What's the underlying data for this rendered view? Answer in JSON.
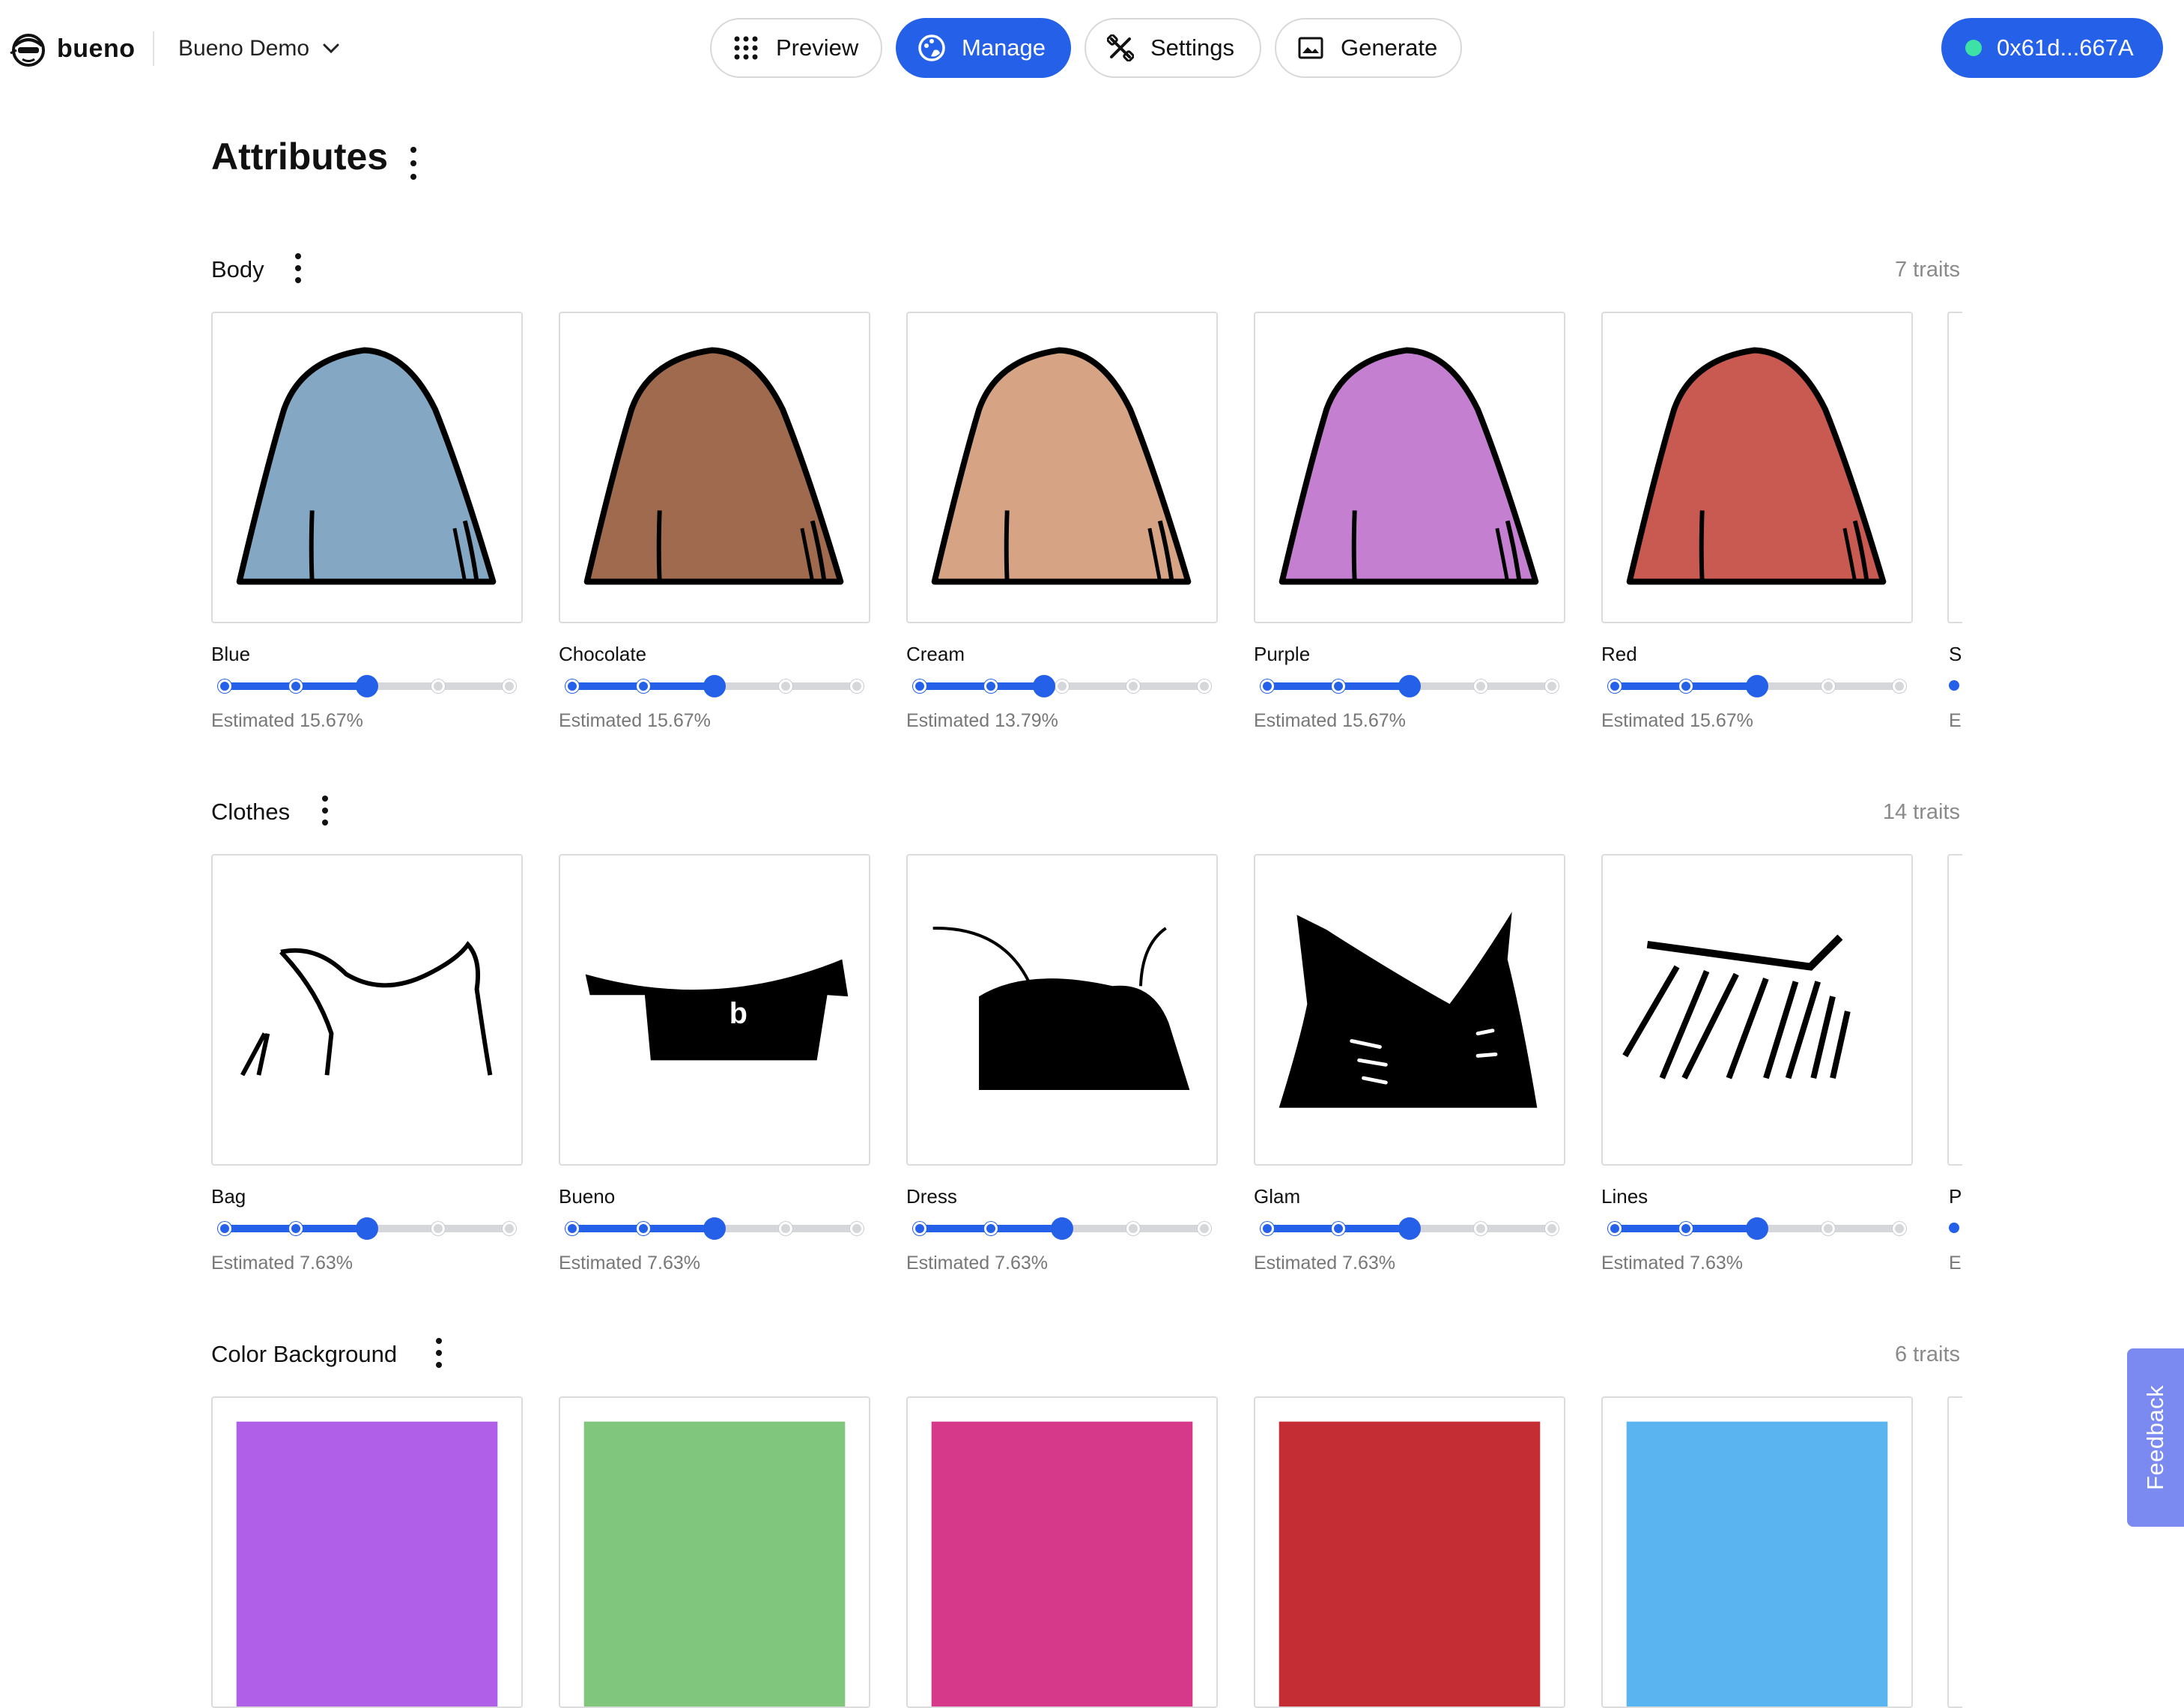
{
  "app": {
    "logo_text": "bueno",
    "project_name": "Bueno Demo"
  },
  "nav": {
    "preview": "Preview",
    "manage": "Manage",
    "settings": "Settings",
    "generate": "Generate",
    "active": "manage"
  },
  "wallet": {
    "address": "0x61d...667A",
    "status_color": "#3ee2a4"
  },
  "page": {
    "title": "Attributes"
  },
  "sections": [
    {
      "title": "Body",
      "count": "7 traits",
      "partial_name": "S",
      "partial_est": "E",
      "traits": [
        {
          "name": "Blue",
          "estimate": "Estimated 15.67%",
          "level": 2,
          "color": "#84a8c4"
        },
        {
          "name": "Chocolate",
          "estimate": "Estimated 15.67%",
          "level": 2,
          "color": "#a06a4f"
        },
        {
          "name": "Cream",
          "estimate": "Estimated 13.79%",
          "level": 1.75,
          "color": "#d6a384"
        },
        {
          "name": "Purple",
          "estimate": "Estimated 15.67%",
          "level": 2,
          "color": "#c57fd1"
        },
        {
          "name": "Red",
          "estimate": "Estimated 15.67%",
          "level": 2,
          "color": "#c85a52"
        }
      ]
    },
    {
      "title": "Clothes",
      "count": "14 traits",
      "partial_name": "P",
      "partial_est": "E",
      "traits": [
        {
          "name": "Bag",
          "estimate": "Estimated 7.63%",
          "level": 2
        },
        {
          "name": "Bueno",
          "estimate": "Estimated 7.63%",
          "level": 2
        },
        {
          "name": "Dress",
          "estimate": "Estimated 7.63%",
          "level": 2
        },
        {
          "name": "Glam",
          "estimate": "Estimated 7.63%",
          "level": 2
        },
        {
          "name": "Lines",
          "estimate": "Estimated 7.63%",
          "level": 2
        }
      ],
      "bueno_glyph": "b"
    },
    {
      "title": "Color Background",
      "count": "6 traits",
      "colors": [
        "#b060e8",
        "#80c67c",
        "#d6398a",
        "#c42d33",
        "#5ab4f0"
      ]
    }
  ],
  "feedback": "Feedback",
  "icons": {
    "logo": "bueno-logo-icon",
    "project": "chevron-down-icon",
    "preview": "grid-icon",
    "manage": "palette-icon",
    "settings": "tools-icon",
    "generate": "image-icon",
    "menu": "kebab-icon"
  }
}
